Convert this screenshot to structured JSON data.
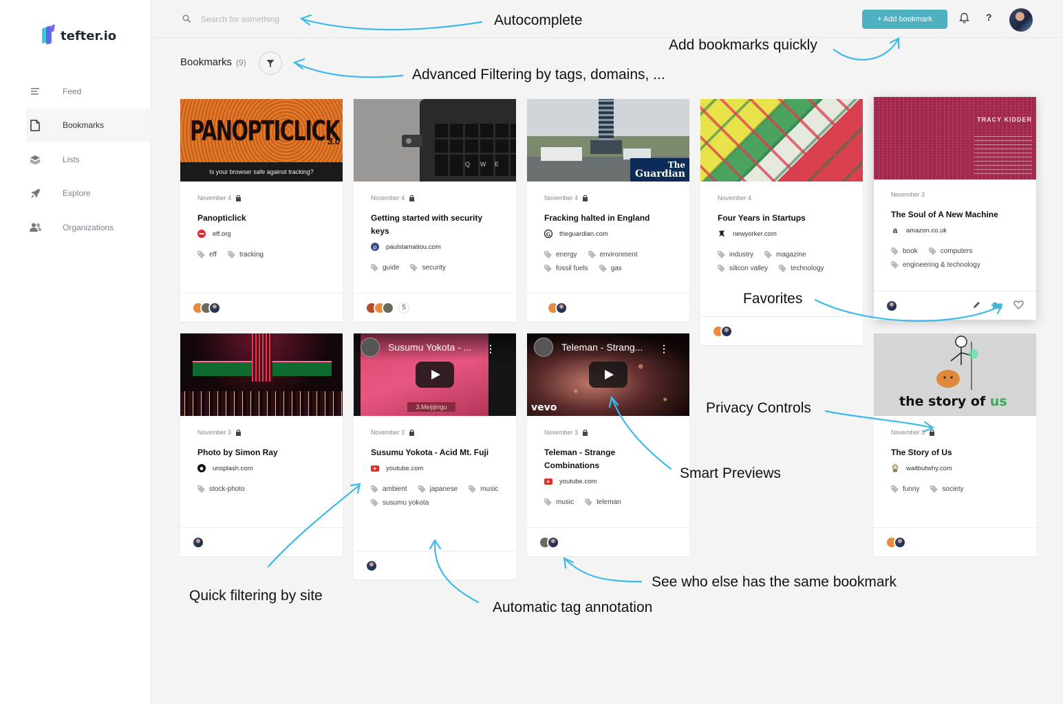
{
  "app": {
    "name": "tefter.io"
  },
  "sidebar": {
    "items": [
      {
        "label": "Feed",
        "icon": "feed-icon",
        "active": false
      },
      {
        "label": "Bookmarks",
        "icon": "document-icon",
        "active": true
      },
      {
        "label": "Lists",
        "icon": "layers-icon",
        "active": false
      },
      {
        "label": "Explore",
        "icon": "rocket-icon",
        "active": false
      },
      {
        "label": "Organizations",
        "icon": "people-icon",
        "active": false
      }
    ]
  },
  "topbar": {
    "search_placeholder": "Search for something",
    "add_label": "+ Add bookmark",
    "help_label": "?"
  },
  "page": {
    "title": "Bookmarks",
    "count": "(9)"
  },
  "cards": [
    {
      "date": "November 4",
      "title": "Panopticlick",
      "site": "eff.org",
      "tags": [
        "eff",
        "tracking"
      ],
      "thumb": {
        "headline": "PANOPTICLICK",
        "version": "3.0",
        "caption": "Is your browser safe against tracking?"
      }
    },
    {
      "date": "November 4",
      "title": "Getting started with security keys",
      "site": "paulstamatiou.com",
      "tags": [
        "guide",
        "security"
      ],
      "more": "5",
      "thumb": {
        "keys": [
          "Q",
          "W",
          "E"
        ]
      }
    },
    {
      "date": "November 4",
      "title": "Fracking halted in England",
      "site": "theguardian.com",
      "tags": [
        "energy",
        "environment",
        "fossil fuels",
        "gas"
      ],
      "thumb": {
        "brand_line1": "The",
        "brand_line2": "Guardian"
      }
    },
    {
      "date": "November 4",
      "title": "Four Years in Startups",
      "site": "newyorker.com",
      "tags": [
        "industry",
        "magazine",
        "silicon valley",
        "technology"
      ]
    },
    {
      "date": "November 3",
      "title": "The Soul of A New Machine",
      "site": "amazon.co.uk",
      "site_glyph": "a",
      "tags": [
        "book",
        "computers",
        "engineering & technology"
      ],
      "thumb": {
        "author": "TRACY KIDDER"
      }
    },
    {
      "date": "November 3",
      "title": "Photo by Simon Ray",
      "site": "unsplash.com",
      "tags": [
        "stock-photo"
      ]
    },
    {
      "date": "November 3",
      "title": "Susumu Yokota - Acid Mt. Fuji",
      "site": "youtube.com",
      "tags": [
        "ambient",
        "japanese",
        "music",
        "susumu yokota"
      ],
      "thumb": {
        "video_title": "Susumu Yokota - ...",
        "overlay": "3.Meijijingu"
      }
    },
    {
      "date": "November 3",
      "title": "Teleman - Strange Combinations",
      "site": "youtube.com",
      "tags": [
        "music",
        "teleman"
      ],
      "thumb": {
        "video_title": "Teleman - Strang...",
        "brand": "vevo"
      }
    },
    {
      "date": "November 3",
      "title": "The Story of Us",
      "site": "waitbutwhy.com",
      "tags": [
        "funny",
        "society"
      ],
      "thumb": {
        "text1": "the story of",
        "text2": "us"
      }
    }
  ],
  "annotations": {
    "autocomplete": "Autocomplete",
    "add_quickly": "Add bookmarks quickly",
    "advanced_filter": "Advanced Filtering by tags, domains, ...",
    "favorites": "Favorites",
    "privacy": "Privacy Controls",
    "smart_previews": "Smart Previews",
    "quick_filter": "Quick filtering by site",
    "auto_tag": "Automatic tag annotation",
    "see_who": "See who else has the same bookmark"
  },
  "colors": {
    "accent": "#4fb0c1",
    "arrow": "#3bb9ea"
  }
}
